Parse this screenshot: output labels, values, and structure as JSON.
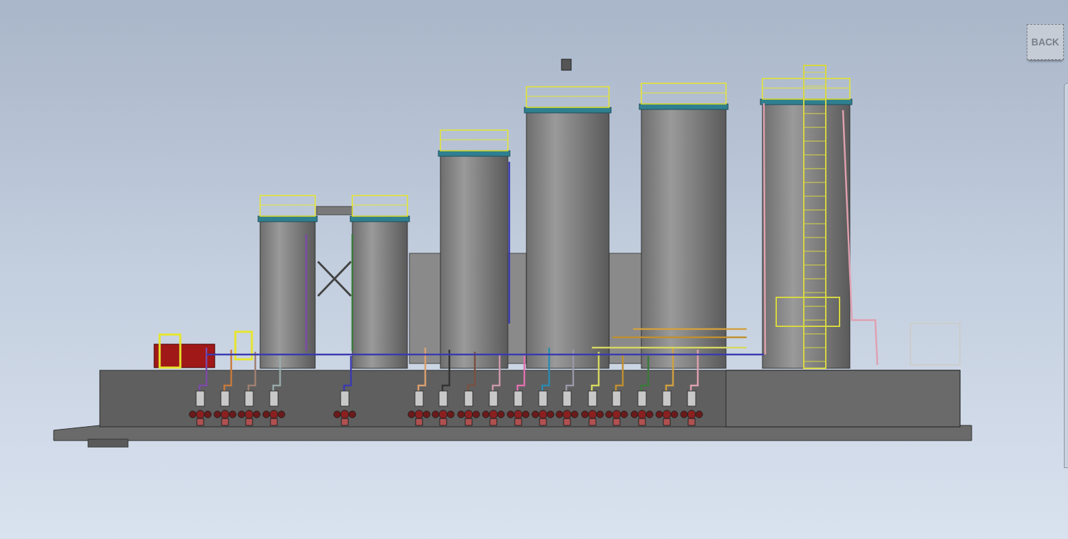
{
  "back_button": {
    "label": "BACK"
  }
}
